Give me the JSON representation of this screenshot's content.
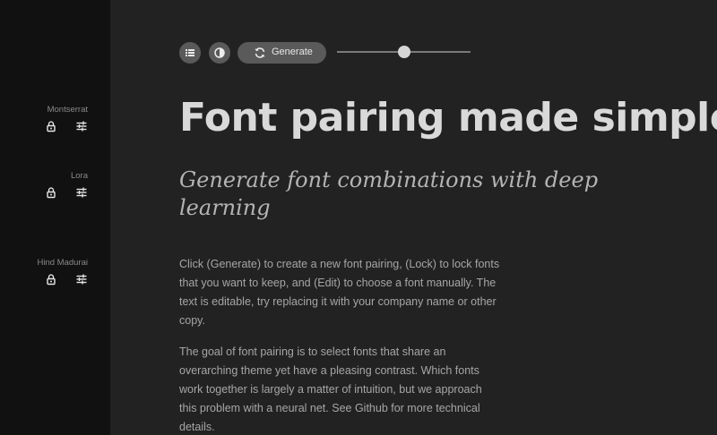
{
  "sidebar": {
    "fonts": [
      {
        "name": "Montserrat",
        "lock_icon": "lock-icon",
        "edit_icon": "sliders-icon"
      },
      {
        "name": "Lora",
        "lock_icon": "lock-icon",
        "edit_icon": "sliders-icon"
      },
      {
        "name": "Hind Madurai",
        "lock_icon": "lock-icon",
        "edit_icon": "sliders-icon"
      }
    ]
  },
  "toolbar": {
    "list_icon": "list-icon",
    "contrast_icon": "contrast-icon",
    "generate_icon": "refresh-icon",
    "generate_label": "Generate",
    "slider_value": 0.5
  },
  "content": {
    "headline": "Font pairing made simple",
    "subheading": "Generate font combinations with deep learning",
    "paragraph1": "Click (Generate) to create a new font pairing, (Lock) to lock fonts that you want to keep, and (Edit) to choose a font manually. The text is editable, try replacing it with your company name or other copy.",
    "paragraph2": "The goal of font pairing is to select fonts that share an overarching theme yet have a pleasing contrast. Which fonts work together is largely a matter of intuition, but we approach this problem with a neural net. See Github for more technical details."
  },
  "colors": {
    "background": "#222222",
    "sidebar": "#111111",
    "button": "#5a5a5a",
    "headline": "#d9d9d9",
    "body_text": "#a6a6a6"
  }
}
